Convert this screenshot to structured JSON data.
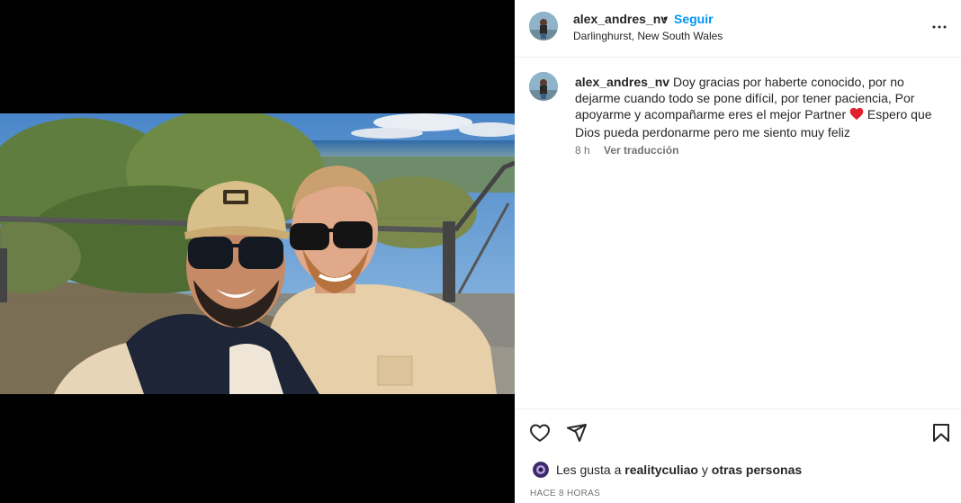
{
  "post": {
    "username": "alex_andres_nv",
    "separator": "•",
    "follow_label": "Seguir",
    "location": "Darlinghurst, New South Wales",
    "photo_description": "selfie-two-men-scenic-lookout",
    "more_icon": "more-horizontal-icon"
  },
  "caption": {
    "username": "alex_andres_nv",
    "text_before_emoji": "Doy gracias por haberte conocido, por no dejarme cuando todo se pone difícil, por tener paciencia, Por apoyarme y acompañarme eres el mejor Partner",
    "emoji": "red-heart",
    "text_after_emoji": "Espero que Dios pueda perdonarme pero me siento muy feliz",
    "time": "8 h",
    "translate_label": "Ver traducción"
  },
  "actions": {
    "like_icon": "heart-icon",
    "share_icon": "send-icon",
    "save_icon": "bookmark-icon"
  },
  "likes": {
    "prefix": "Les gusta a",
    "user": "realityculiao",
    "connector": "y",
    "others": "otras personas"
  },
  "timestamp": "HACE 8 HORAS",
  "colors": {
    "link": "#0095f6",
    "text": "#262626",
    "secondary": "#737373",
    "heart": "#ed4956"
  }
}
